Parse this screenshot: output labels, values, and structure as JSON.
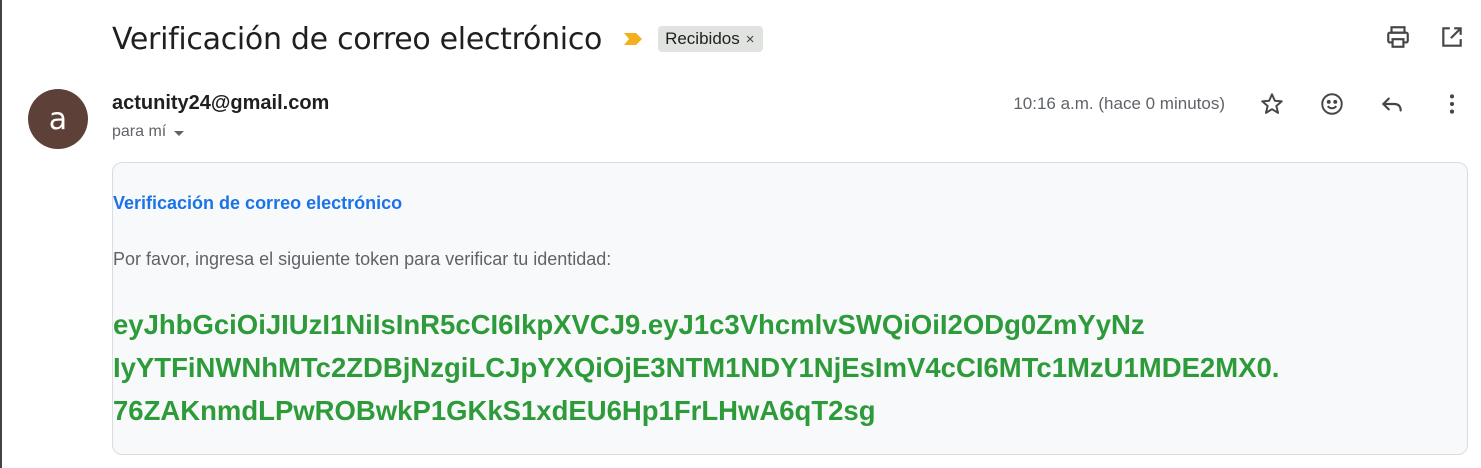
{
  "email": {
    "subject": "Verificación de correo electrónico",
    "label": "Recibidos",
    "label_remove": "×",
    "sender_initial": "a",
    "sender_email": "actunity24@gmail.com",
    "recipient": "para mí",
    "time": "10:16 a.m. (hace 0 minutos)"
  },
  "icons": {
    "importance": "importance-marker-icon",
    "print": "printer-icon",
    "new_window": "open-in-new-window-icon",
    "star": "star-icon",
    "emoji": "emoji-reaction-icon",
    "reply": "reply-icon",
    "more": "more-vertical-icon"
  },
  "body": {
    "heading": "Verificación de correo electrónico",
    "instruction": "Por favor, ingresa el siguiente token para verificar tu identidad:",
    "token_lines": [
      "eyJhbGciOiJIUzI1NiIsInR5cCI6IkpXVCJ9.eyJ1c3VhcmlvSWQiOiI2ODg0ZmYyNz",
      "IyYTFiNWNhMTc2ZDBjNzgiLCJpYXQiOjE3NTM1NDY1NjEsImV4cCI6MTc1MzU1MDE2MX0.",
      "76ZAKnmdLPwROBwkP1GKkS1xdEU6Hp1FrLHwA6qT2sg"
    ]
  },
  "colors": {
    "avatar_bg": "#5d4037",
    "heading": "#1a73e8",
    "token": "#2e9b3a",
    "importance": "#f2b01e"
  }
}
